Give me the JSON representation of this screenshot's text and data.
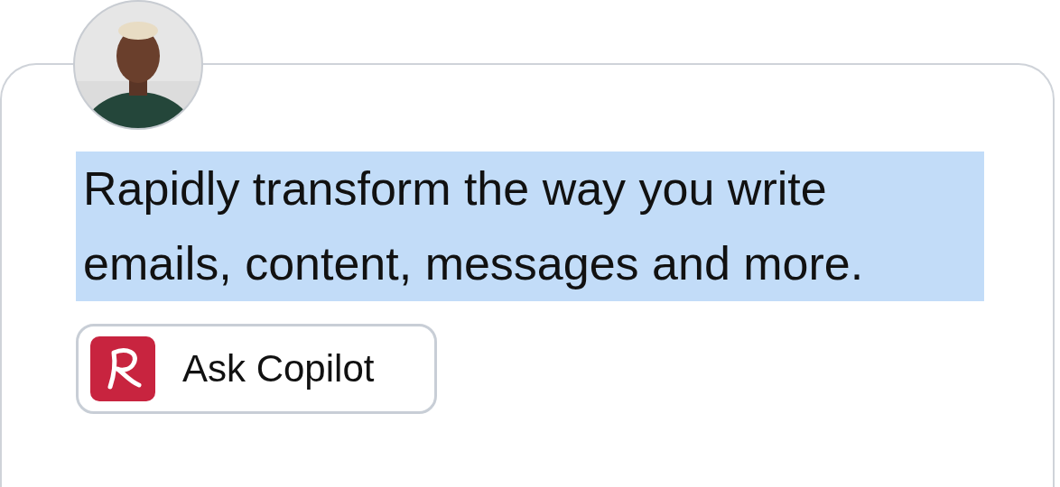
{
  "message": {
    "text": "Rapidly transform the way you write emails, content, messages and more.",
    "selected": true
  },
  "button": {
    "label": "Ask Copilot"
  }
}
